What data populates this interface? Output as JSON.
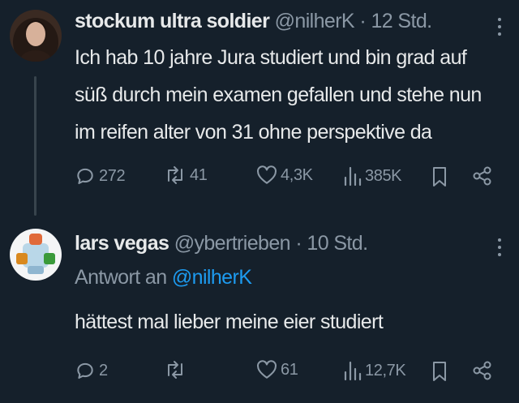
{
  "tweets": [
    {
      "name": "stockum ultra soldier",
      "handle": "@nilherK",
      "separator": "·",
      "time": "12 Std.",
      "text": "Ich hab 10 jahre Jura studiert und bin grad auf süß durch mein examen gefallen und stehe nun im reifen alter von 31 ohne perspektive da",
      "replies": "272",
      "retweets": "41",
      "likes": "4,3K",
      "views": "385K"
    },
    {
      "name": "lars vegas",
      "handle": "@ybertrieben",
      "separator": "·",
      "time": "10 Std.",
      "reply_prefix": "Antwort an",
      "reply_handle": "@nilherK",
      "text": "hättest mal lieber meine eier studiert",
      "replies": "2",
      "retweets": "",
      "likes": "61",
      "views": "12,7K"
    }
  ],
  "icons": {
    "reply": "reply-icon",
    "retweet": "retweet-icon",
    "like": "heart-icon",
    "views": "views-icon",
    "bookmark": "bookmark-icon",
    "share": "share-icon",
    "more": "more-icon"
  },
  "colors": {
    "background": "#15202b",
    "text": "#e7e9ea",
    "secondary": "#8b98a5",
    "accent": "#1d9bf0",
    "thread_line": "#38444d"
  }
}
